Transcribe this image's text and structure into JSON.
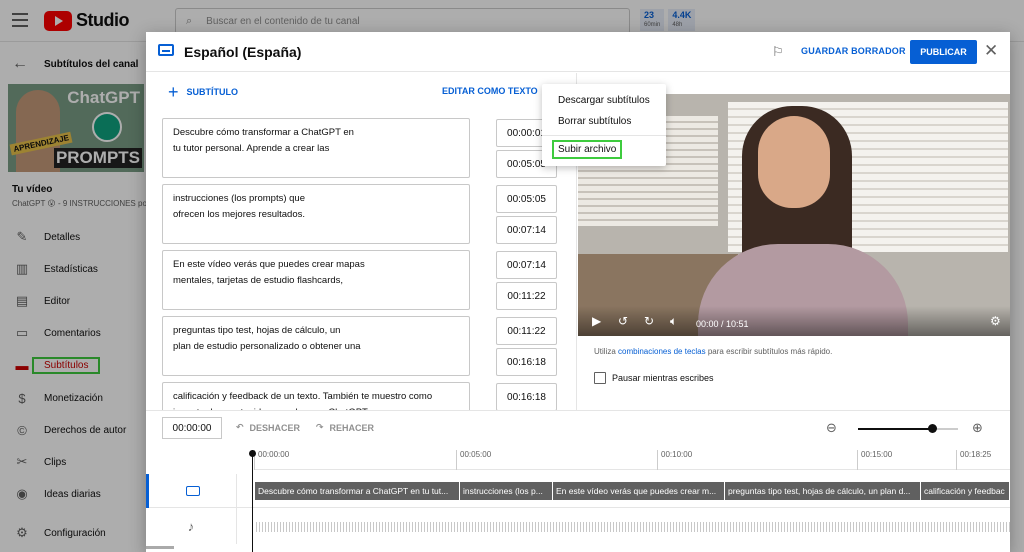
{
  "topbar": {
    "app_name": "Studio",
    "search_placeholder": "Buscar en el contenido de tu canal",
    "stat1_value": "23",
    "stat1_label": "60min",
    "stat2_value": "4.4K",
    "stat2_label": "48h"
  },
  "sidebar": {
    "section_title": "Subtítulos del canal",
    "thumb_text_top": "ChatGPT",
    "thumb_text_bottom": "PROMPTS",
    "thumb_tag": "APRENDIZAJE",
    "thumb_duration": "10:5",
    "your_video": "Tu vídeo",
    "video_title": "ChatGPT 😮 - 9 INSTRUCCIONES po...",
    "items": [
      {
        "label": "Detalles",
        "icon": "pencil-icon",
        "glyph": "✎"
      },
      {
        "label": "Estadísticas",
        "icon": "analytics-icon",
        "glyph": "▥"
      },
      {
        "label": "Editor",
        "icon": "film-icon",
        "glyph": "▤"
      },
      {
        "label": "Comentarios",
        "icon": "comment-icon",
        "glyph": "▭"
      },
      {
        "label": "Subtítulos",
        "icon": "subtitles-icon",
        "glyph": "▬",
        "active": true
      },
      {
        "label": "Monetización",
        "icon": "dollar-icon",
        "glyph": "$"
      },
      {
        "label": "Derechos de autor",
        "icon": "copyright-icon",
        "glyph": "©"
      },
      {
        "label": "Clips",
        "icon": "scissors-icon",
        "glyph": "✂"
      },
      {
        "label": "Ideas diarias",
        "icon": "lightbulb-icon",
        "glyph": "◉"
      },
      {
        "label": "Configuración",
        "icon": "gear-icon",
        "glyph": "⚙"
      }
    ]
  },
  "dialog": {
    "title": "Español (España)",
    "save_draft": "GUARDAR BORRADOR",
    "publish": "PUBLICAR",
    "add_subtitle": "SUBTÍTULO",
    "edit_as_text": "EDITAR COMO TEXTO",
    "menu": [
      "Descargar subtítulos",
      "Borrar subtítulos",
      "Subir archivo"
    ],
    "cues": [
      {
        "text": "Descubre cómo transformar a ChatGPT en\ntu tutor personal. Aprende a crear las",
        "start": "00:00:01",
        "end": "00:05:05"
      },
      {
        "text": "instrucciones (los prompts) que\nofrecen los mejores resultados.",
        "start": "00:05:05",
        "end": "00:07:14"
      },
      {
        "text": "En este vídeo verás que puedes crear mapas\nmentales, tarjetas de estudio flashcards,",
        "start": "00:07:14",
        "end": "00:11:22"
      },
      {
        "text": "preguntas tipo test, hojas de cálculo, un\nplan de estudio personalizado o obtener una",
        "start": "00:11:22",
        "end": "00:16:18"
      },
      {
        "text": "calificación y feedback de un texto. También te muestro como\nimportar los contenidos creados con ChatGPT en",
        "start": "00:16:18",
        "end": ""
      }
    ],
    "video_time": "00:00 / 10:51",
    "hint_prefix": "Utiliza ",
    "hint_link": "combinaciones de teclas",
    "hint_suffix": " para escribir subtítulos más rápido.",
    "pause_label": "Pausar mientras escribes",
    "timecode": "00:00:00",
    "undo": "DESHACER",
    "redo": "REHACER",
    "ruler": [
      "00:00:00",
      "00:05:00",
      "00:10:00",
      "00:15:00",
      "00:18:25"
    ],
    "segments": [
      "Descubre cómo transformar a ChatGPT en tu tut...",
      "instrucciones (los p...",
      "En este vídeo verás que puedes crear m...",
      "preguntas tipo test, hojas de cálculo, un plan d...",
      "calificación y feedbac"
    ]
  },
  "colors": {
    "accent": "#065fd4",
    "brand_red": "#ff0000",
    "highlight_green": "#3ecb3e"
  }
}
